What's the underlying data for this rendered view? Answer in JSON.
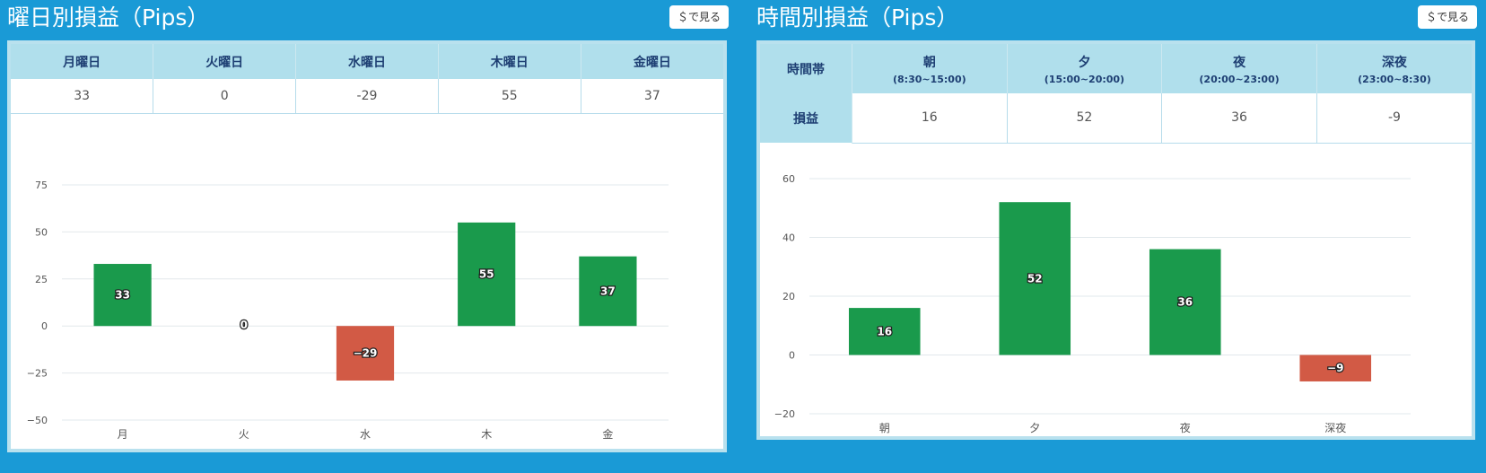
{
  "colors": {
    "background": "#1a9ad6",
    "positive": "#1a9a4c",
    "negative": "#d25a45",
    "header": "#b0dfec",
    "header_text": "#1e3f73"
  },
  "weekday": {
    "title": "曜日別損益（Pips）",
    "button_label": "＄で見る",
    "table": {
      "headers": [
        "月曜日",
        "火曜日",
        "水曜日",
        "木曜日",
        "金曜日"
      ],
      "values": [
        "33",
        "0",
        "-29",
        "55",
        "37"
      ]
    }
  },
  "hour": {
    "title": "時間別損益（Pips）",
    "button_label": "＄で見る",
    "table": {
      "row_header_top": "時間帯",
      "row_header_bottom": "損益",
      "headers": [
        {
          "name": "朝",
          "range": "(8:30~15:00)"
        },
        {
          "name": "夕",
          "range": "(15:00~20:00)"
        },
        {
          "name": "夜",
          "range": "(20:00~23:00)"
        },
        {
          "name": "深夜",
          "range": "(23:00~8:30)"
        }
      ],
      "values": [
        "16",
        "52",
        "36",
        "-9"
      ]
    }
  },
  "chart_data": [
    {
      "type": "bar",
      "categories": [
        "月",
        "火",
        "水",
        "木",
        "金"
      ],
      "values": [
        33,
        0,
        -29,
        55,
        37
      ],
      "ylim": [
        -50,
        75
      ],
      "yticks": [
        -50,
        -25,
        0,
        25,
        50,
        75
      ],
      "ytick_labels": [
        "−50",
        "−25",
        "0",
        "25",
        "50",
        "75"
      ],
      "data_labels": [
        "33",
        "0",
        "−29",
        "55",
        "37"
      ],
      "grid": true
    },
    {
      "type": "bar",
      "categories": [
        "朝",
        "夕",
        "夜",
        "深夜"
      ],
      "values": [
        16,
        52,
        36,
        -9
      ],
      "ylim": [
        -20,
        60
      ],
      "yticks": [
        -20,
        0,
        20,
        40,
        60
      ],
      "ytick_labels": [
        "−20",
        "0",
        "20",
        "40",
        "60"
      ],
      "data_labels": [
        "16",
        "52",
        "36",
        "−9"
      ],
      "grid": true
    }
  ]
}
